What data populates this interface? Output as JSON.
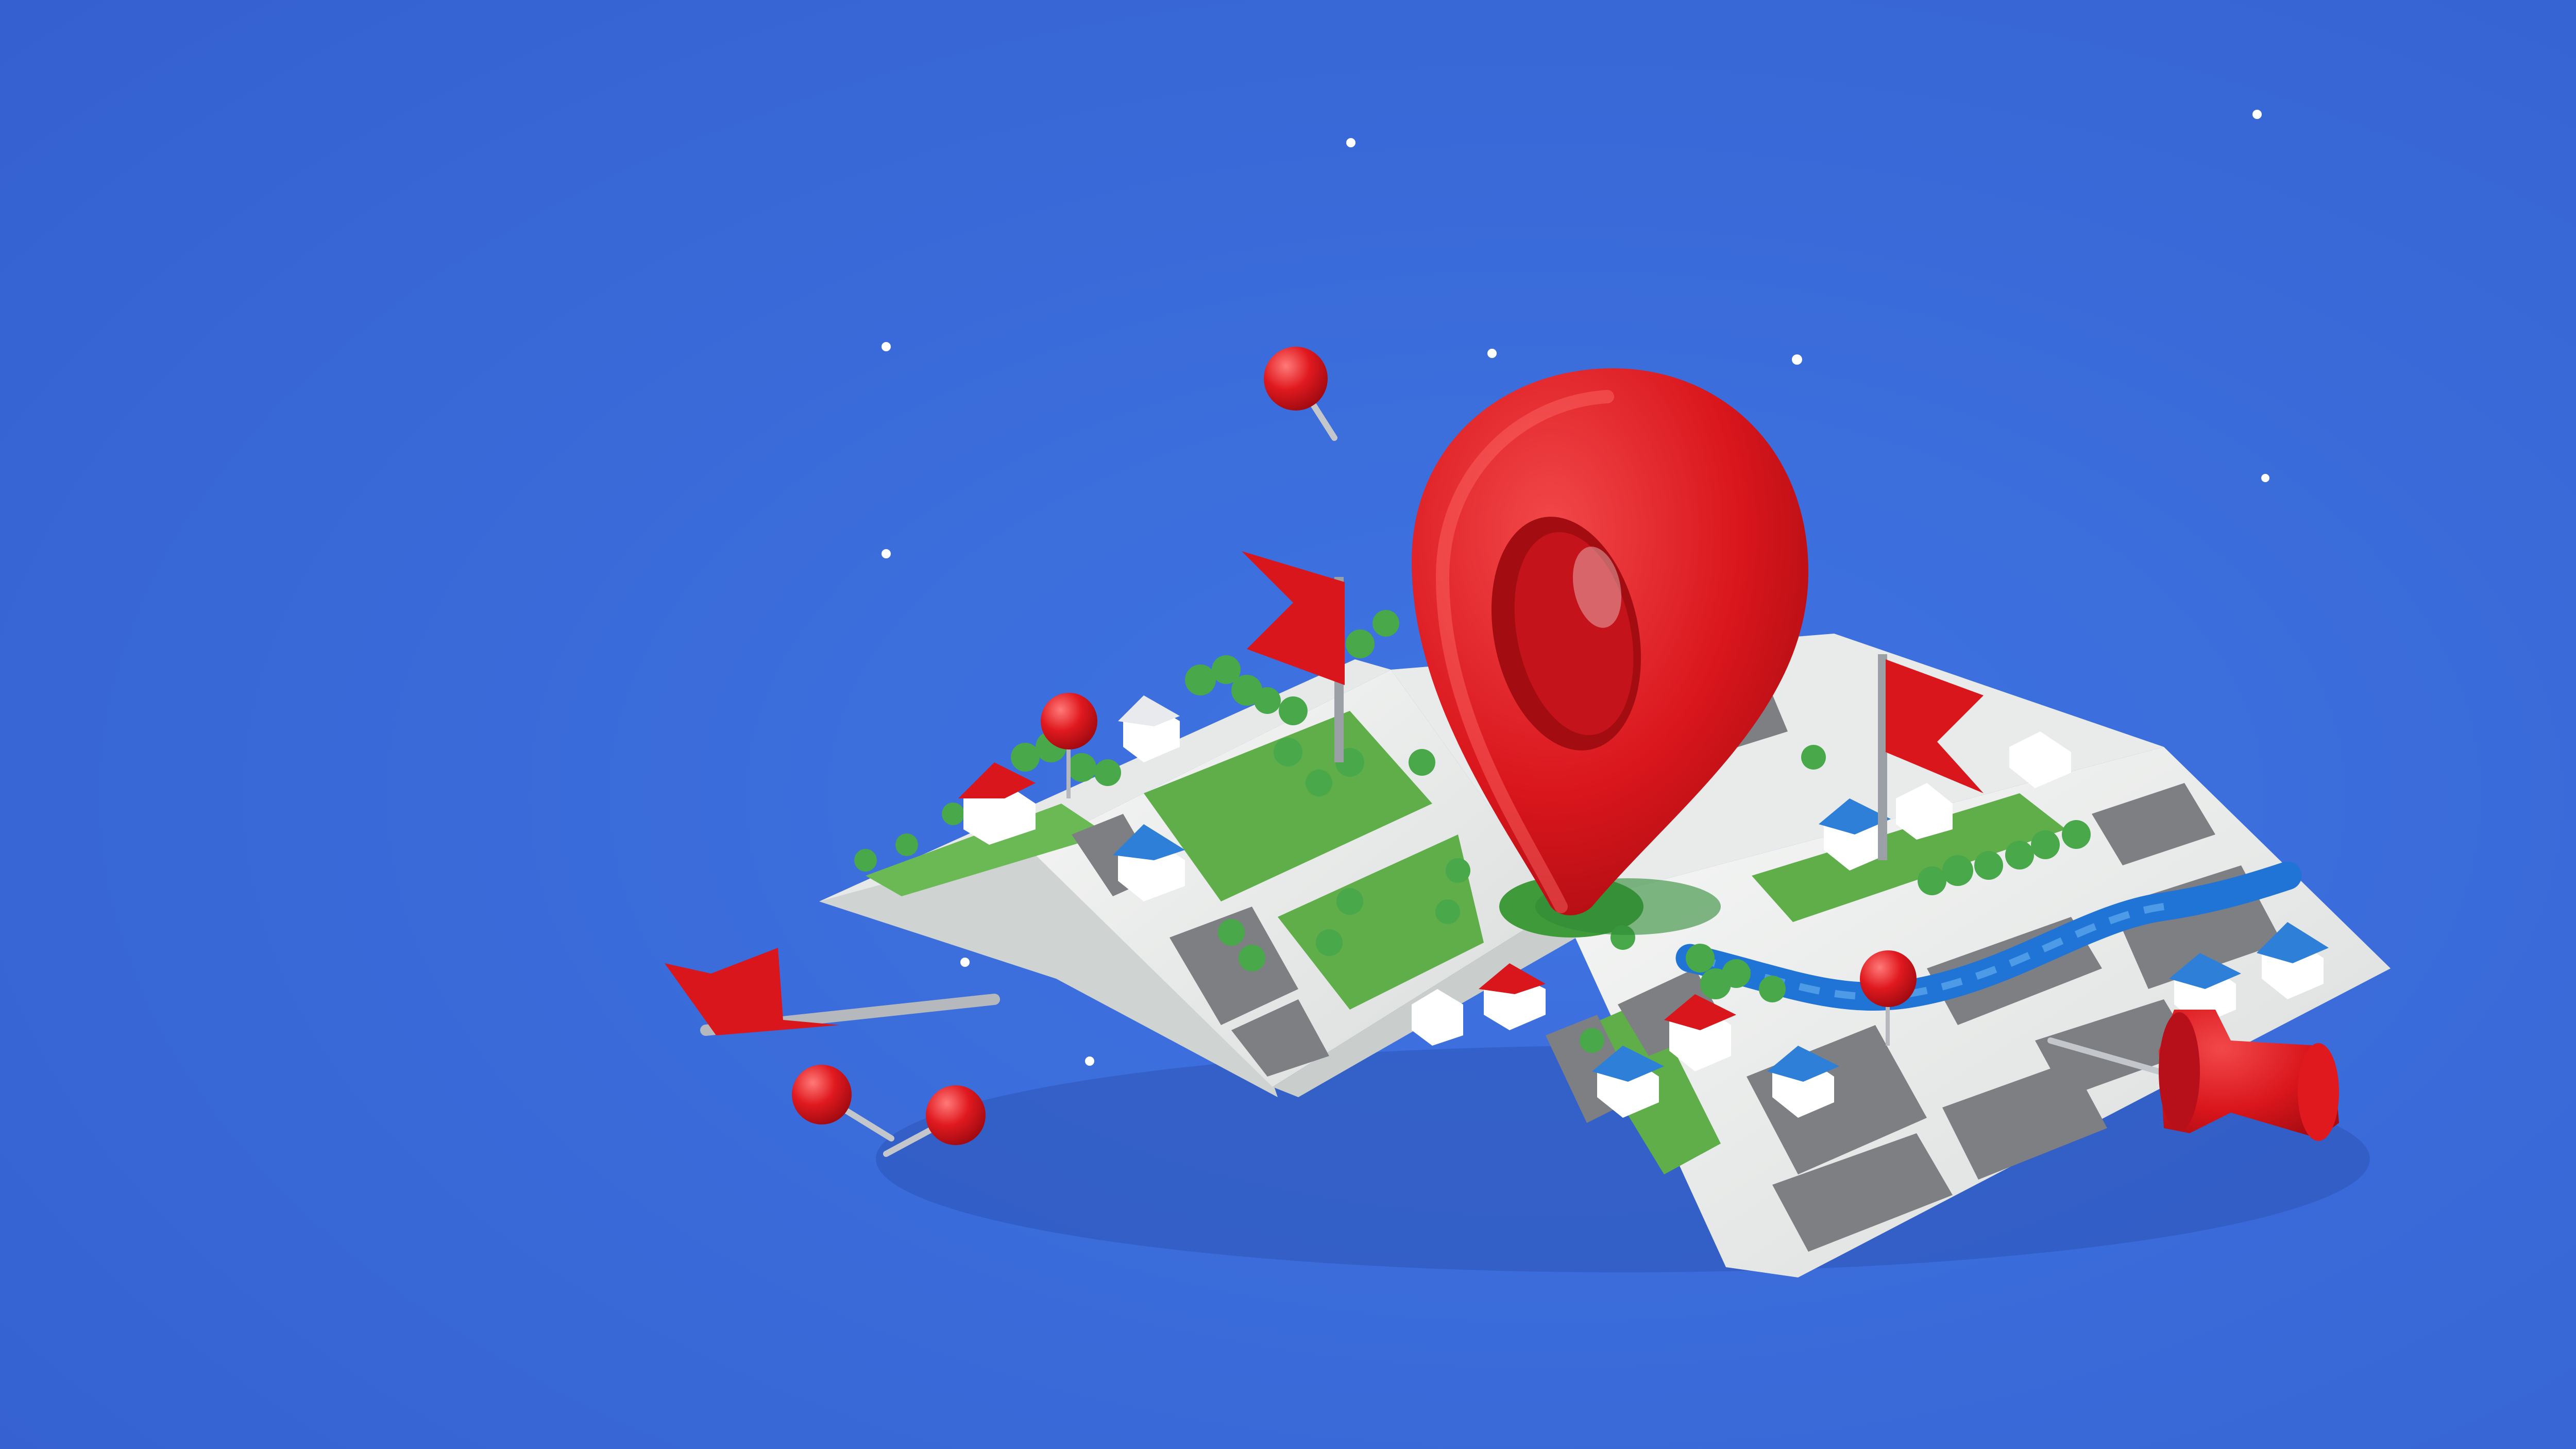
{
  "scene": {
    "subject": "folded-city-map-with-location-pin",
    "background_color": "#3b6ad6",
    "accent_red": "#d9161c",
    "map_paper": "#eef0ee",
    "map_block_gray": "#7d7f83",
    "map_park_green": "#5fae4a",
    "river_blue": "#1f74d6",
    "icons": [
      "location-pin-icon",
      "flag-icon",
      "push-pin-icon",
      "thumbtack-icon",
      "house-icon",
      "tree-icon",
      "sparkle-dot-icon"
    ]
  }
}
